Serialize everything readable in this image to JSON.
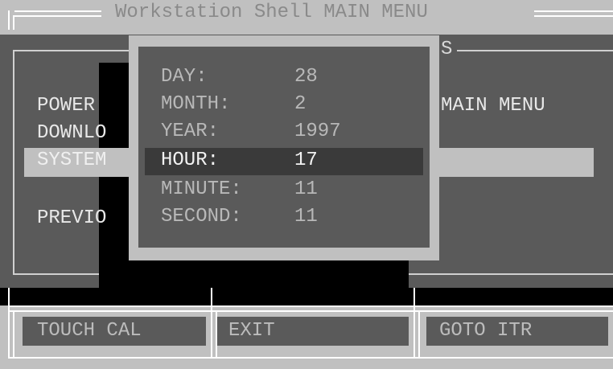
{
  "main_menu": {
    "title": "Workstation Shell MAIN MENU",
    "items": {
      "power": "POWER",
      "download": "DOWNLO",
      "system": "SYSTEM",
      "previous": "PREVIO"
    },
    "right_label": "MAIN MENU",
    "right_frame_title_fragment": "S"
  },
  "datetime_dialog": {
    "fields": [
      {
        "label": "DAY:",
        "value": "28"
      },
      {
        "label": "MONTH:",
        "value": "2"
      },
      {
        "label": "YEAR:",
        "value": "1997"
      },
      {
        "label": "HOUR:",
        "value": "17"
      },
      {
        "label": "MINUTE:",
        "value": "11"
      },
      {
        "label": "SECOND:",
        "value": "11"
      }
    ],
    "selected_field": "HOUR:"
  },
  "bottom_buttons": {
    "touch_cal": "TOUCH CAL",
    "exit": "EXIT",
    "goto_itr": "GOTO ITR"
  },
  "colors": {
    "screen_light": "#c0c0c0",
    "panel_dark": "#5a5a5a",
    "shadow_black": "#000000",
    "text_dark": "#000000",
    "text_light": "#e0e0e0"
  }
}
